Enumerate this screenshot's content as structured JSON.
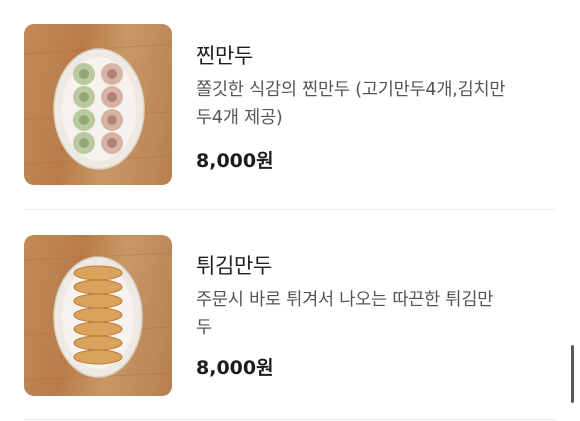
{
  "menu": {
    "items": [
      {
        "name": "찐만두",
        "desc_line1": "쫄깃한 식감의 찐만두 (고기만두4개,김치만",
        "desc_line2": "두4개 제공)",
        "price": "8,000원",
        "image": "steamed-dumplings-photo"
      },
      {
        "name": "튀김만두",
        "desc_line1": "주문시 바로 튀겨서 나오는 따끈한 튀김만",
        "desc_line2": "두",
        "price": "8,000원",
        "image": "fried-dumplings-photo"
      }
    ]
  },
  "colors": {
    "text": "#222222",
    "desc": "#555555",
    "divider": "#ececec"
  }
}
